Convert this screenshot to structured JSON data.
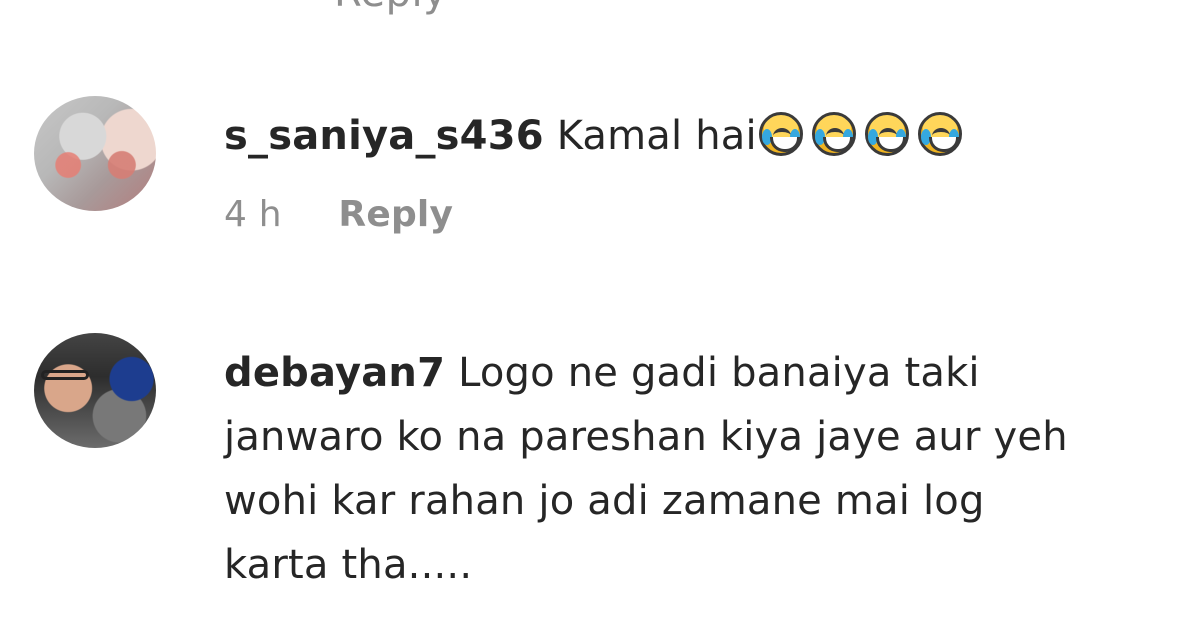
{
  "top_cut": "Reply",
  "comments": [
    {
      "username": "s_saniya_s436",
      "text": "Kamal hai",
      "time": "4 h",
      "reply": "Reply",
      "emoji_name": "face-with-tears-of-joy-icon"
    },
    {
      "username": "debayan7",
      "text_lines": [
        "Logo ne gadi banaiya taki",
        "janwaro ko na pareshan kiya jaye aur yeh",
        "wohi kar rahan jo adi zamane mai log",
        "karta tha....."
      ]
    }
  ]
}
